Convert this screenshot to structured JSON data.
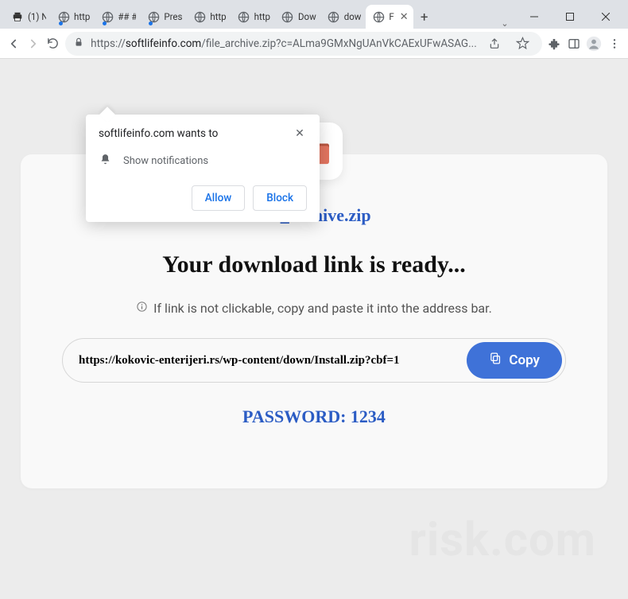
{
  "tabs": [
    {
      "label": "(1) N",
      "favicon": "printer"
    },
    {
      "label": "http",
      "favicon": "globe",
      "dot": true
    },
    {
      "label": "## #",
      "favicon": "globe",
      "dot": true
    },
    {
      "label": "Pres",
      "favicon": "globe",
      "dot": true
    },
    {
      "label": "http",
      "favicon": "globe"
    },
    {
      "label": "http",
      "favicon": "globe"
    },
    {
      "label": "Dow",
      "favicon": "globe"
    },
    {
      "label": "dow",
      "favicon": "globe"
    },
    {
      "label": "F",
      "favicon": "globe",
      "active": true
    }
  ],
  "url": {
    "proto": "https://",
    "host": "softlifeinfo.com",
    "path": "/file_archive.zip?c=ALma9GMxNgUAnVkCAExUFwASAG..."
  },
  "notif": {
    "title": "softlifeinfo.com wants to",
    "message": "Show notifications",
    "allow": "Allow",
    "block": "Block"
  },
  "content": {
    "title": "file_archive.zip",
    "heading": "Your download link is ready...",
    "hint": "If link is not clickable, copy and paste it into the address bar.",
    "link": "https://kokovic-enterijeri.rs/wp-content/down/Install.zip?cbf=1",
    "copy": "Copy",
    "password": "PASSWORD: 1234"
  },
  "watermark": "risk.com"
}
